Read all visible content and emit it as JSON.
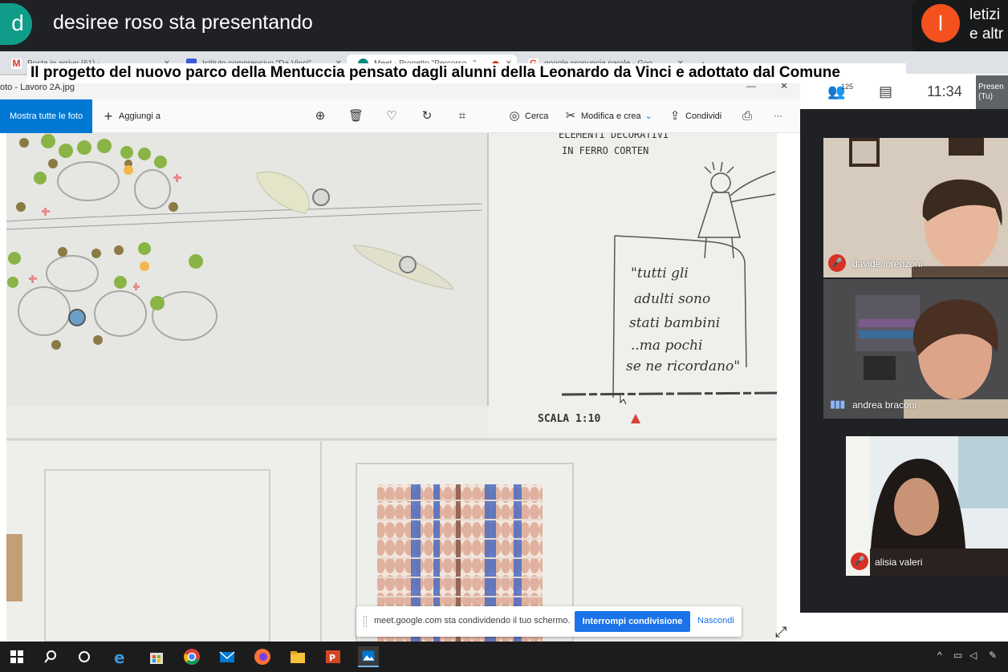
{
  "meet": {
    "presenter_initial": "d",
    "presenter_text": "desiree roso sta presentando",
    "corner_initial": "l",
    "corner_line1": "letizi",
    "corner_line2": "e altr",
    "colors": {
      "meet_dark": "#202124",
      "presenter_avatar": "#0f9d8a",
      "corner_avatar": "#f4511e",
      "mute_red": "#d93025",
      "share_blue": "#1a73e8"
    }
  },
  "news": {
    "title": "Il progetto del nuovo parco della Mentuccia pensato dagli alunni della Leonardo da Vinci e adottato dal Comune"
  },
  "browser": {
    "tabs": [
      {
        "label": "Posta in arrivo (61) - ...",
        "icon": "gmail-icon"
      },
      {
        "label": "Istituto comprensivo \"Da Vinci\"",
        "icon": "document-icon"
      },
      {
        "label": "Meet - Progetto \"Percorso...\"",
        "icon": "meet-icon",
        "active": true
      },
      {
        "label": "google pronuncia parole - Goo...",
        "icon": "google-icon"
      }
    ]
  },
  "photos": {
    "window_title": "oto - Lavoro 2A.jpg",
    "show_all": "Mostra tutte le foto",
    "add_to": "Aggiungi a",
    "search": "Cerca",
    "edit_create": "Modifica e crea",
    "share": "Condividi",
    "more": "···"
  },
  "drawing": {
    "header_line1": "ELEMENTI DECORATIVI",
    "header_line2": "IN FERRO CORTEN",
    "quote": [
      "\"tutti gli",
      "adulti sono",
      "stati bambini",
      "..ma pochi",
      "se ne ricordano\""
    ],
    "scale": "SCALA 1:10"
  },
  "share_notice": {
    "message": "meet.google.com sta condividendo il tuo schermo.",
    "stop": "Interrompi condivisione",
    "hide": "Nascondi"
  },
  "meet_panel": {
    "people_count": "125",
    "time": "11:34",
    "present": [
      "Presen",
      "(Tu)"
    ],
    "participants": [
      {
        "name": "davide lorenzoni",
        "status": "muted"
      },
      {
        "name": "andrea braconi",
        "status": "speaking"
      },
      {
        "name": "alisia valeri",
        "status": "muted"
      }
    ]
  }
}
